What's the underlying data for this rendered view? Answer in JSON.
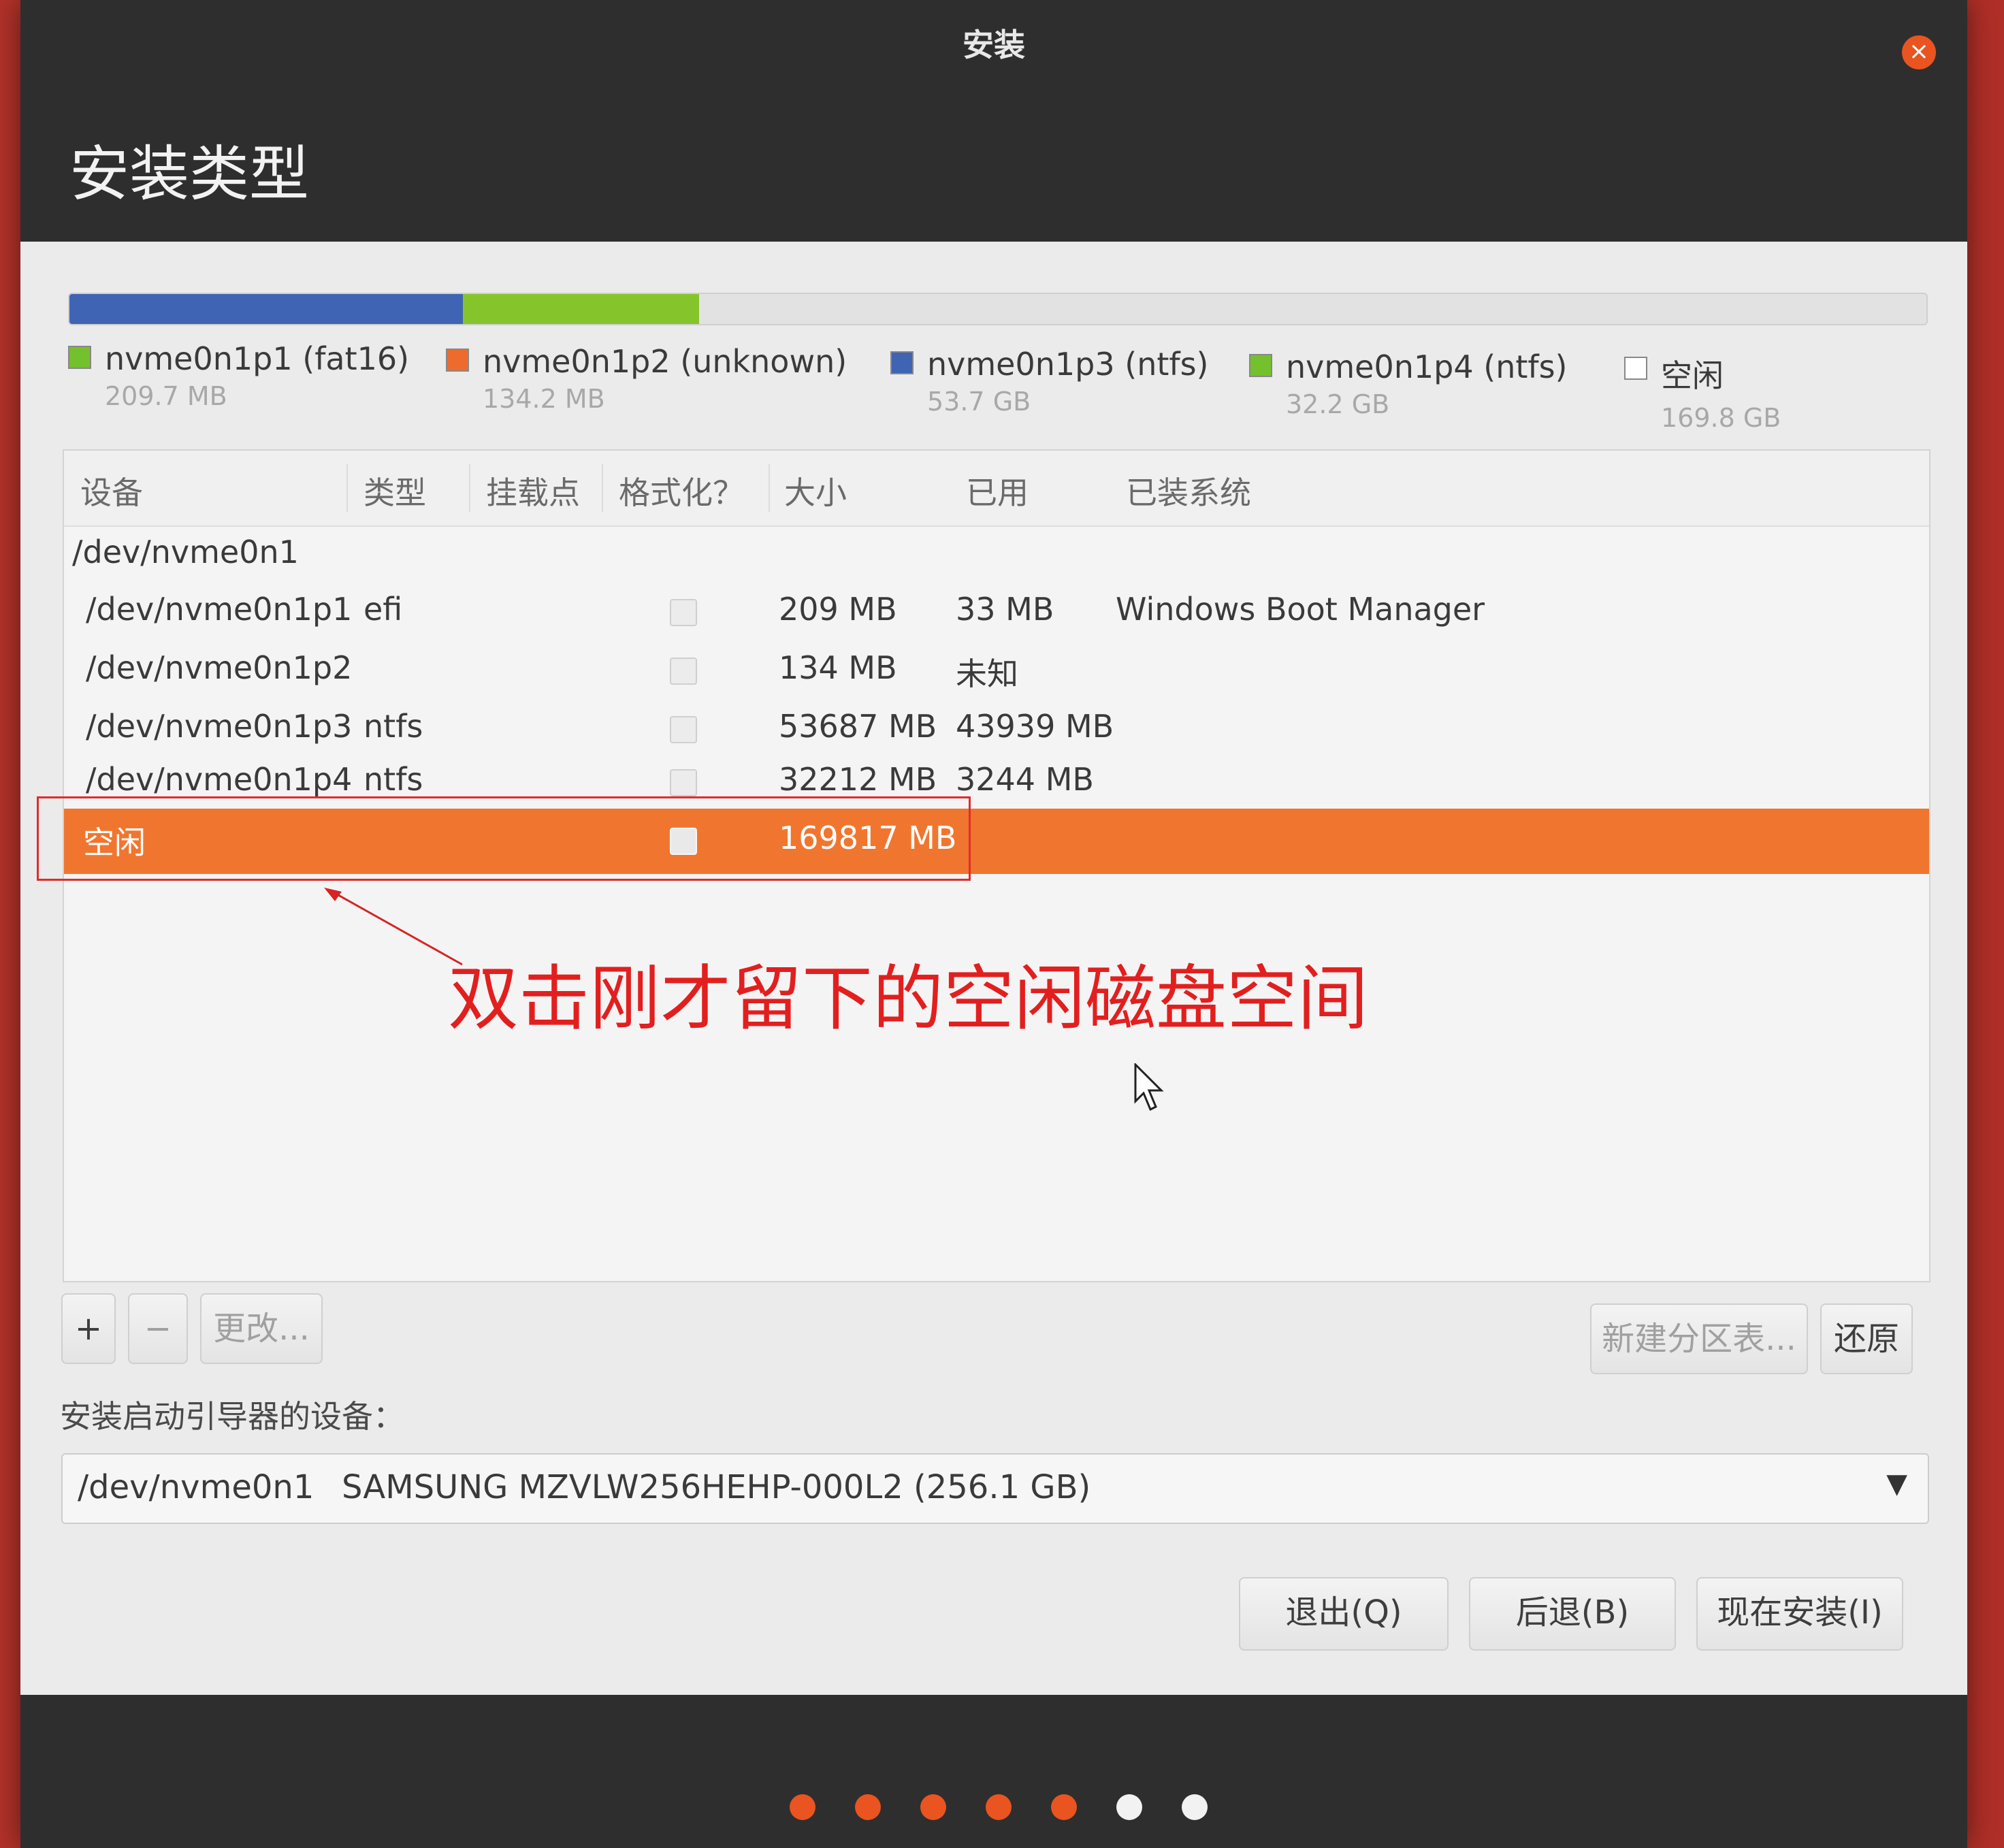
{
  "window": {
    "title": "安装",
    "close": "×"
  },
  "page": {
    "title": "安装类型"
  },
  "partition_bar": {
    "segments": [
      {
        "name": "p3",
        "color": "#3e64b3",
        "fraction": 0.212
      },
      {
        "name": "p4",
        "color": "#86c42c",
        "fraction": 0.127
      },
      {
        "name": "free",
        "color": "#e2e2e2",
        "fraction": 0.661
      }
    ]
  },
  "legend": [
    {
      "name": "nvme0n1p1 (fat16)",
      "size": "209.7 MB",
      "color": "#74c12d"
    },
    {
      "name": "nvme0n1p2 (unknown)",
      "size": "134.2 MB",
      "color": "#ee6b2d"
    },
    {
      "name": "nvme0n1p3 (ntfs)",
      "size": "53.7 GB",
      "color": "#3e64b3"
    },
    {
      "name": "nvme0n1p4 (ntfs)",
      "size": "32.2 GB",
      "color": "#74c12d"
    },
    {
      "name": "空闲",
      "size": "169.8 GB",
      "color": "#ffffff"
    }
  ],
  "table": {
    "headers": {
      "device": "设备",
      "type": "类型",
      "mount": "挂载点",
      "format": "格式化？",
      "size": "大小",
      "used": "已用",
      "system": "已装系统"
    },
    "disk": "/dev/nvme0n1",
    "rows": [
      {
        "device": "/dev/nvme0n1p1",
        "type": "efi",
        "size": "209 MB",
        "used": "33 MB",
        "system": "Windows Boot Manager"
      },
      {
        "device": "/dev/nvme0n1p2",
        "type": "",
        "size": "134 MB",
        "used": "未知",
        "system": ""
      },
      {
        "device": "/dev/nvme0n1p3",
        "type": "ntfs",
        "size": "53687 MB",
        "used": "43939 MB",
        "system": ""
      },
      {
        "device": "/dev/nvme0n1p4",
        "type": "ntfs",
        "size": "32212 MB",
        "used": "3244 MB",
        "system": ""
      },
      {
        "device": "空闲",
        "type": "",
        "size": "169817 MB",
        "used": "",
        "system": ""
      }
    ]
  },
  "annotation": "双击刚才留下的空闲磁盘空间",
  "toolbar": {
    "add": "+",
    "remove": "−",
    "change": "更改...",
    "new_table": "新建分区表...",
    "revert": "还原"
  },
  "bootloader": {
    "label": "安装启动引导器的设备：",
    "device": "/dev/nvme0n1",
    "model": "SAMSUNG MZVLW256HEHP-000L2 (256.1 GB)"
  },
  "nav": {
    "quit": "退出(Q)",
    "back": "后退(B)",
    "install": "现在安装(I)"
  },
  "progress": {
    "total": 7,
    "done": 5,
    "done_color": "#e95420",
    "todo_color": "#f2f2f2"
  }
}
